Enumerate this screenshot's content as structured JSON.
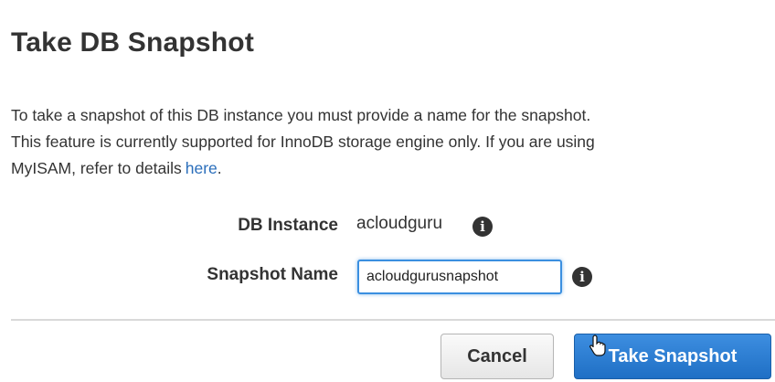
{
  "dialog": {
    "title": "Take DB Snapshot",
    "description": {
      "line1": "To take a snapshot of this DB instance you must provide a name for the snapshot.",
      "line2": "This feature is currently supported for InnoDB storage engine only. If you are using",
      "line3_prefix": "MyISAM, refer to details",
      "link_text": "here",
      "line3_suffix": "."
    }
  },
  "form": {
    "instance": {
      "label": "DB Instance",
      "value": "acloudguru",
      "info_icon": "info-icon"
    },
    "snapshot_name": {
      "label": "Snapshot Name",
      "value": "acloudgurusnapshot",
      "info_icon": "info-icon"
    }
  },
  "footer": {
    "cancel_label": "Cancel",
    "submit_label": "Take Snapshot"
  },
  "colors": {
    "link": "#2a6ebb",
    "primary_button": "#1f6fc5",
    "input_focus_border": "#3b8fe0",
    "text": "#333333"
  }
}
